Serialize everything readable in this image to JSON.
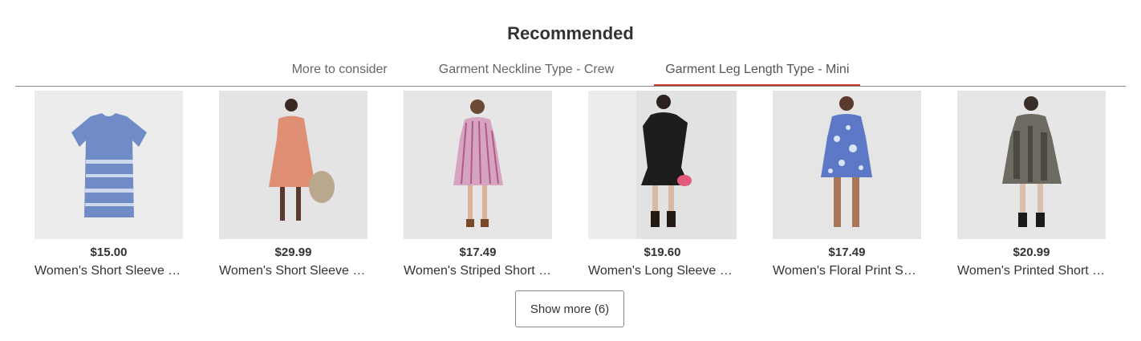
{
  "section": {
    "title": "Recommended"
  },
  "tabs": [
    {
      "label": "More to consider",
      "active": false
    },
    {
      "label": "Garment Neckline Type - Crew",
      "active": false
    },
    {
      "label": "Garment Leg Length Type - Mini",
      "active": true
    }
  ],
  "accent_color": "#c9362a",
  "products": [
    {
      "price": "$15.00",
      "name": "Women's Short Sleeve T-Shirt Dress",
      "image": "blue-tie-dye-tshirt-dress"
    },
    {
      "price": "$29.99",
      "name": "Women's Short Sleeve Babydoll Dress",
      "image": "terracotta-babydoll-dress"
    },
    {
      "price": "$17.49",
      "name": "Women's Striped Short Sleeve Dress",
      "image": "pink-striped-dress"
    },
    {
      "price": "$19.60",
      "name": "Women's Long Sleeve Ruffle Dress",
      "image": "black-long-sleeve-dress"
    },
    {
      "price": "$17.49",
      "name": "Women's Floral Print Short Sleeve Dress",
      "image": "blue-floral-dress"
    },
    {
      "price": "$20.99",
      "name": "Women's Printed Short Sleeve Dress",
      "image": "gray-printed-dress"
    }
  ],
  "show_more": {
    "label": "Show more (6)"
  }
}
